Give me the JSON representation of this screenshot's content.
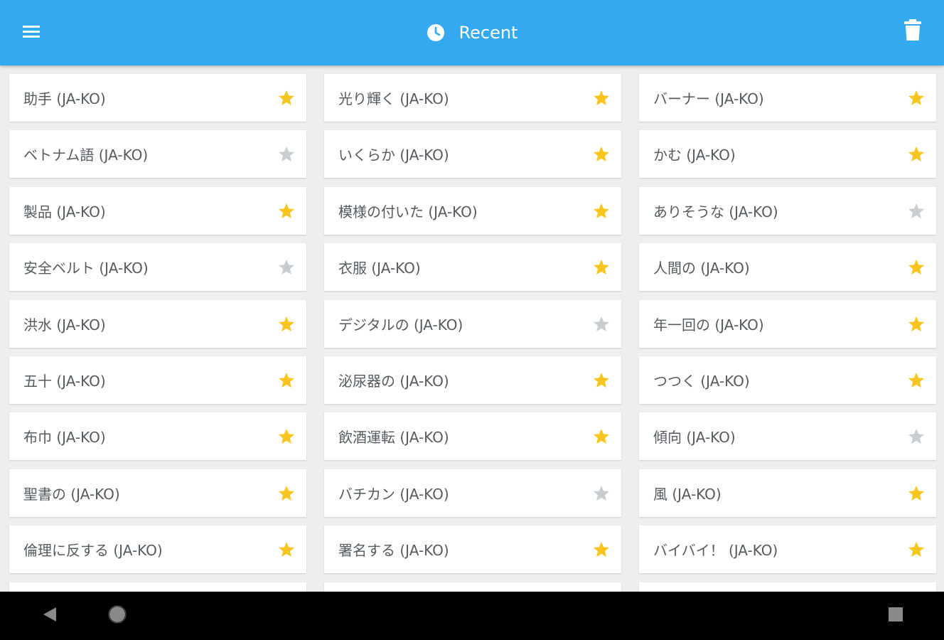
{
  "appbar": {
    "title": "Recent",
    "menu_icon": "menu-icon",
    "title_icon": "clock-icon",
    "action_icon": "trash-icon",
    "background_color": "#34a9f0"
  },
  "colors": {
    "star_active": "#f7c51d",
    "star_inactive": "#c9cdd1",
    "label_text": "#555a60"
  },
  "items": [
    {
      "label": "助手 (JA-KO)",
      "starred": true
    },
    {
      "label": "光り輝く (JA-KO)",
      "starred": true
    },
    {
      "label": "バーナー (JA-KO)",
      "starred": true
    },
    {
      "label": "ベトナム語 (JA-KO)",
      "starred": false
    },
    {
      "label": "いくらか (JA-KO)",
      "starred": true
    },
    {
      "label": "かむ (JA-KO)",
      "starred": true
    },
    {
      "label": "製品 (JA-KO)",
      "starred": true
    },
    {
      "label": "模様の付いた (JA-KO)",
      "starred": true
    },
    {
      "label": "ありそうな (JA-KO)",
      "starred": false
    },
    {
      "label": "安全ベルト (JA-KO)",
      "starred": false
    },
    {
      "label": "衣服 (JA-KO)",
      "starred": true
    },
    {
      "label": "人間の (JA-KO)",
      "starred": true
    },
    {
      "label": "洪水 (JA-KO)",
      "starred": true
    },
    {
      "label": "デジタルの (JA-KO)",
      "starred": false
    },
    {
      "label": "年一回の (JA-KO)",
      "starred": true
    },
    {
      "label": "五十 (JA-KO)",
      "starred": true
    },
    {
      "label": "泌尿器の (JA-KO)",
      "starred": true
    },
    {
      "label": "つつく (JA-KO)",
      "starred": true
    },
    {
      "label": "布巾 (JA-KO)",
      "starred": true
    },
    {
      "label": "飲酒運転 (JA-KO)",
      "starred": true
    },
    {
      "label": "傾向 (JA-KO)",
      "starred": false
    },
    {
      "label": "聖書の (JA-KO)",
      "starred": true
    },
    {
      "label": "バチカン (JA-KO)",
      "starred": false
    },
    {
      "label": "風 (JA-KO)",
      "starred": true
    },
    {
      "label": "倫理に反する (JA-KO)",
      "starred": true
    },
    {
      "label": "署名する (JA-KO)",
      "starred": true
    },
    {
      "label": "バイバイ！ (JA-KO)",
      "starred": true
    },
    {
      "label": "",
      "starred": false
    },
    {
      "label": "",
      "starred": false
    },
    {
      "label": "",
      "starred": false
    }
  ],
  "navbar": {
    "back_icon": "back-triangle-icon",
    "home_icon": "home-circle-icon",
    "recents_icon": "recents-square-icon"
  }
}
